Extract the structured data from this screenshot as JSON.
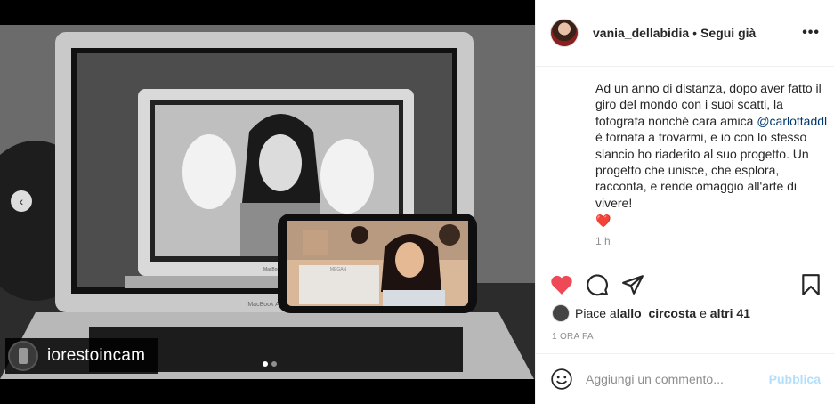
{
  "media": {
    "watermark_text": "iorestoincam",
    "dots_total": 2,
    "dots_active_index": 0,
    "photo_labels": {
      "laptop_brand_main": "MacBook Air",
      "laptop_brand_inner": "MacBook Air",
      "machine_brand": "MEGAN"
    }
  },
  "post": {
    "username": "vania_dellabidia",
    "separator": "•",
    "follow_label": "Segui già",
    "more_label": "•••",
    "caption_part1": "Ad un anno di distanza, dopo aver fatto il giro del mondo con i suoi scatti, la fotografa nonché cara amica ",
    "caption_mention": "@carlottaddl",
    "caption_part2": " è tornata a trovarmi, e io con lo stesso slancio ho riaderito al suo progetto. Un progetto che unisce, che esplora, racconta, e rende omaggio all'arte di vivere!",
    "caption_emoji": "❤️",
    "caption_time": "1 h"
  },
  "likes": {
    "prefix": "Piace a ",
    "user": "lallo_circosta",
    "middle": " e ",
    "others": "altri 41"
  },
  "timestamp": "1 ORA FA",
  "comment": {
    "placeholder": "Aggiungi un commento...",
    "publish_label": "Pubblica"
  },
  "colors": {
    "like_red": "#ed4956",
    "publish_blue": "#b2dffc",
    "mention_blue": "#00376b",
    "text": "#262626",
    "muted": "#8e8e8e"
  }
}
